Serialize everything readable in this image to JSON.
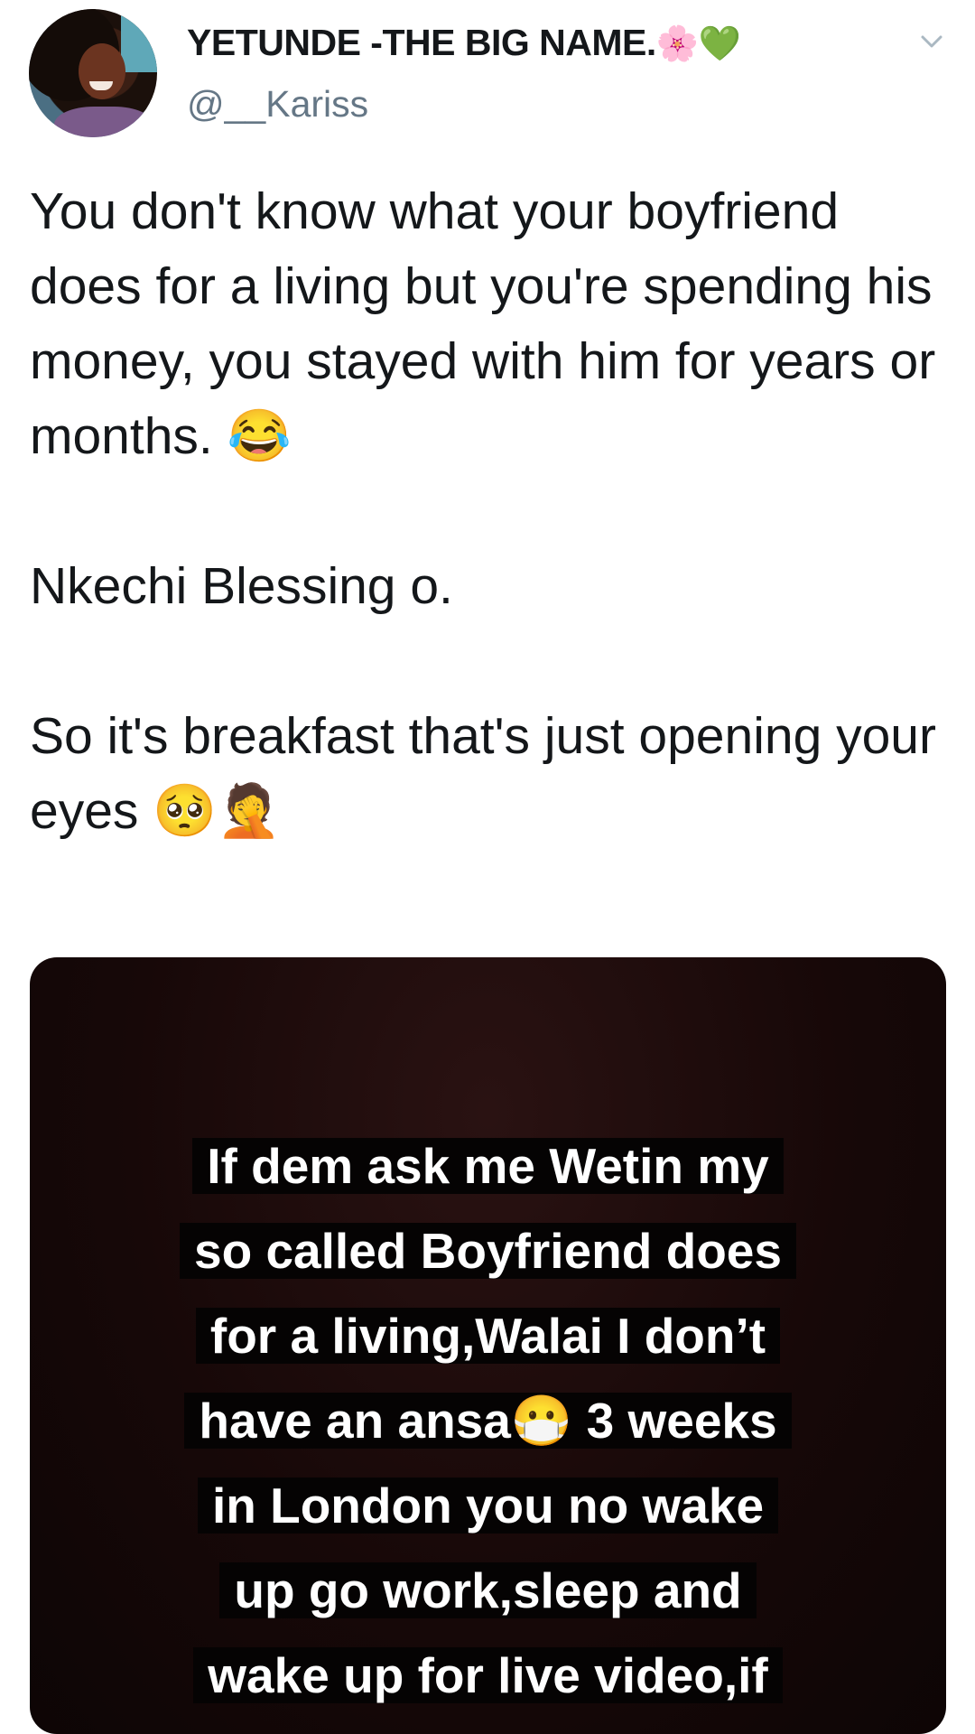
{
  "tweet": {
    "author": {
      "display_name": "YETUNDE -THE BIG NAME.",
      "name_emojis": "🌸💚",
      "handle": "@__Kariss"
    },
    "text_paragraphs": [
      "You don't know what your boyfriend does for a living but you're spending his money, you stayed with him for years or months. 😂",
      "Nkechi Blessing o.",
      "So it's breakfast that's just opening your eyes 🥺🤦"
    ],
    "media": {
      "caption_lines": [
        "If dem ask me Wetin my",
        "so called Boyfriend does",
        "for a living,Walai I don’t",
        "have an ansa😷 3 weeks",
        "in London you no wake",
        "up go work,sleep and",
        "wake up for live video,if"
      ]
    },
    "icons": {
      "menu": "chevron-down-icon"
    }
  }
}
